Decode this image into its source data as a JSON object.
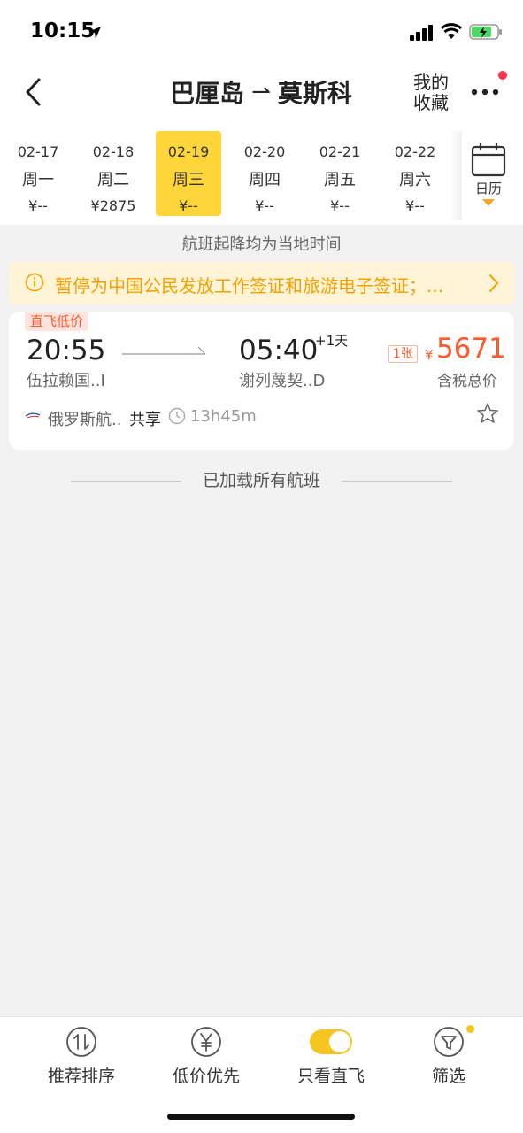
{
  "status_bar": {
    "time": "10:15"
  },
  "nav": {
    "origin": "巴厘岛",
    "route_arrow": "⇀",
    "destination": "莫斯科",
    "favorites_line1": "我的",
    "favorites_line2": "收藏"
  },
  "dates": [
    {
      "date": "02-17",
      "weekday": "周一",
      "price": "¥--"
    },
    {
      "date": "02-18",
      "weekday": "周二",
      "price": "¥2875"
    },
    {
      "date": "02-19",
      "weekday": "周三",
      "price": "¥--",
      "selected": true
    },
    {
      "date": "02-20",
      "weekday": "周四",
      "price": "¥--"
    },
    {
      "date": "02-21",
      "weekday": "周五",
      "price": "¥--"
    },
    {
      "date": "02-22",
      "weekday": "周六",
      "price": "¥--"
    }
  ],
  "calendar_label": "日历",
  "local_time_note": "航班起降均为当地时间",
  "notice": "暂停为中国公民发放工作签证和旅游电子签证；...",
  "flight": {
    "tag": "直飞低价",
    "departure_time": "20:55",
    "departure_airport": "伍拉赖国..I",
    "arrival_time": "05:40",
    "plus_day": "+1天",
    "arrival_airport": "谢列蔑契..D",
    "tickets": "1张",
    "currency": "¥",
    "price": "5671",
    "price_note": "含税总价",
    "airline": "俄罗斯航..",
    "share": "共享",
    "duration": "13h45m"
  },
  "loaded_all": "已加载所有航班",
  "bottom_tabs": {
    "recommend": "推荐排序",
    "low_price": "低价优先",
    "direct_only": "只看直飞",
    "filter": "筛选"
  },
  "colors": {
    "accent_yellow": "#ffd63a",
    "price_orange": "#ff5a2d",
    "notice_text": "#f5a000",
    "notice_bg": "#fff4d6"
  }
}
